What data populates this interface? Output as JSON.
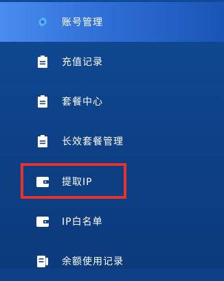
{
  "sidebar": {
    "items": [
      {
        "label": "账号管理",
        "icon": "gear-icon",
        "active": true
      },
      {
        "label": "充值记录",
        "icon": "document-icon",
        "active": false
      },
      {
        "label": "套餐中心",
        "icon": "document-icon",
        "active": false
      },
      {
        "label": "长效套餐管理",
        "icon": "document-icon",
        "active": false
      },
      {
        "label": "提取IP",
        "icon": "wallet-icon",
        "active": false
      },
      {
        "label": "IP白名单",
        "icon": "wallet-icon",
        "active": false
      },
      {
        "label": "余额使用记录",
        "icon": "receipt-icon",
        "active": false
      }
    ]
  },
  "colors": {
    "sidebar_bg": "#0f3f86",
    "active_bg": "#3a7ce6",
    "text": "#ffffff",
    "icon_light": "#ffffff",
    "icon_active": "#5fb2ff",
    "highlight_border": "#e8322e"
  }
}
